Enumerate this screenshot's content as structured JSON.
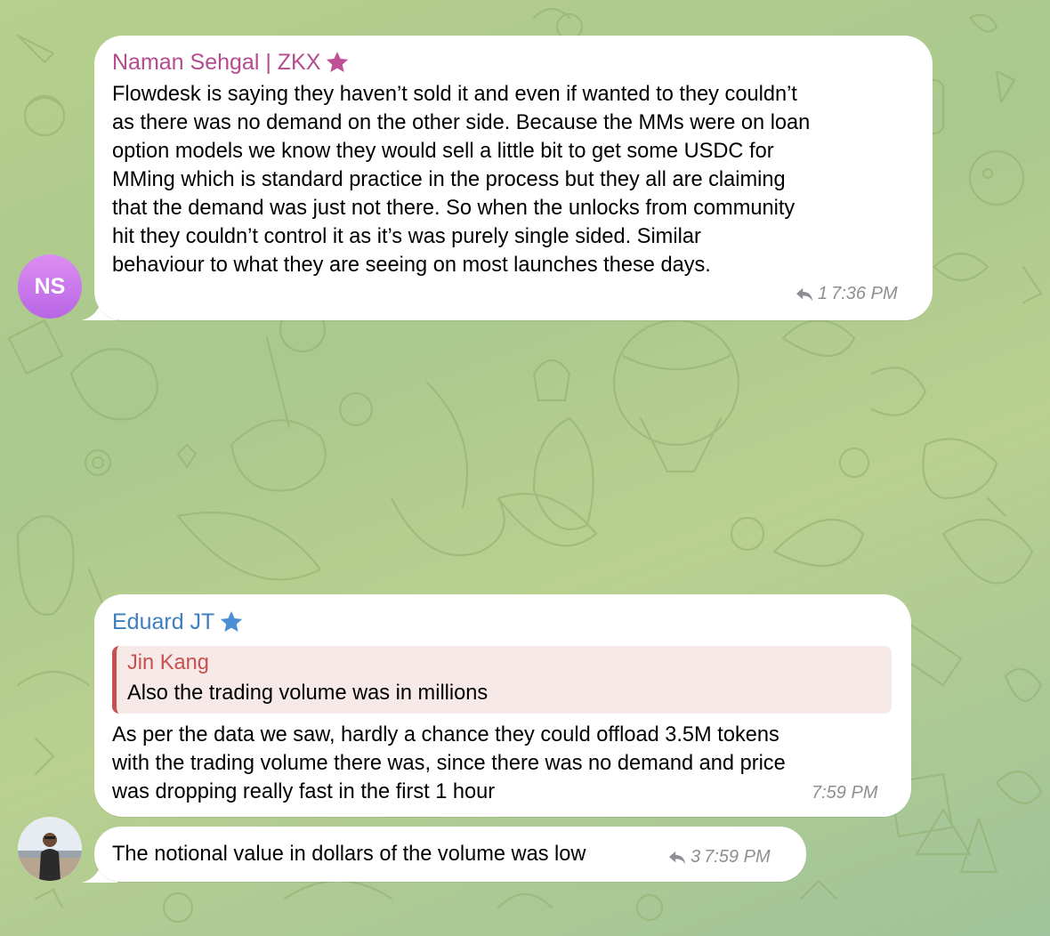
{
  "messages": [
    {
      "sender": "Naman Sehgal | ZKX",
      "sender_color": "#b54b8e",
      "avatar_initials": "NS",
      "lines": [
        "Flowdesk is saying they haven’t sold it and even if wanted to they couldn’t",
        "as there was no demand on the other side. Because the MMs were on loan",
        "option models we know they would sell a little bit to get some USDC for",
        "MMing which is standard practice in the process but they all are claiming",
        "that the demand was just not there. So when the unlocks from community",
        "hit they couldn’t control it as it’s was purely single sided. Similar",
        "behaviour to what they are seeing on most launches these days."
      ],
      "reply_count": "1",
      "time": "7:36 PM"
    },
    {
      "sender": "Eduard JT",
      "sender_color": "#3b7fbf",
      "quote": {
        "name": "Jin Kang",
        "text": "Also the trading volume was in millions"
      },
      "lines": [
        "As per the data we saw, hardly a chance they could offload 3.5M tokens",
        "with the trading volume there was, since there was no demand and price",
        "was dropping really fast in the first 1 hour"
      ],
      "time": "7:59 PM"
    },
    {
      "text": "The notional value in dollars of the volume was low",
      "reply_count": "3",
      "time": "7:59 PM"
    }
  ],
  "colors": {
    "star_pink": "#c04f95",
    "star_blue": "#4a8fd4",
    "quote_accent": "#c5504c",
    "quote_bg": "#f8e9e9",
    "meta_gray": "#8e8e93"
  },
  "icons": [
    "star-icon",
    "reply-arrow-icon"
  ]
}
